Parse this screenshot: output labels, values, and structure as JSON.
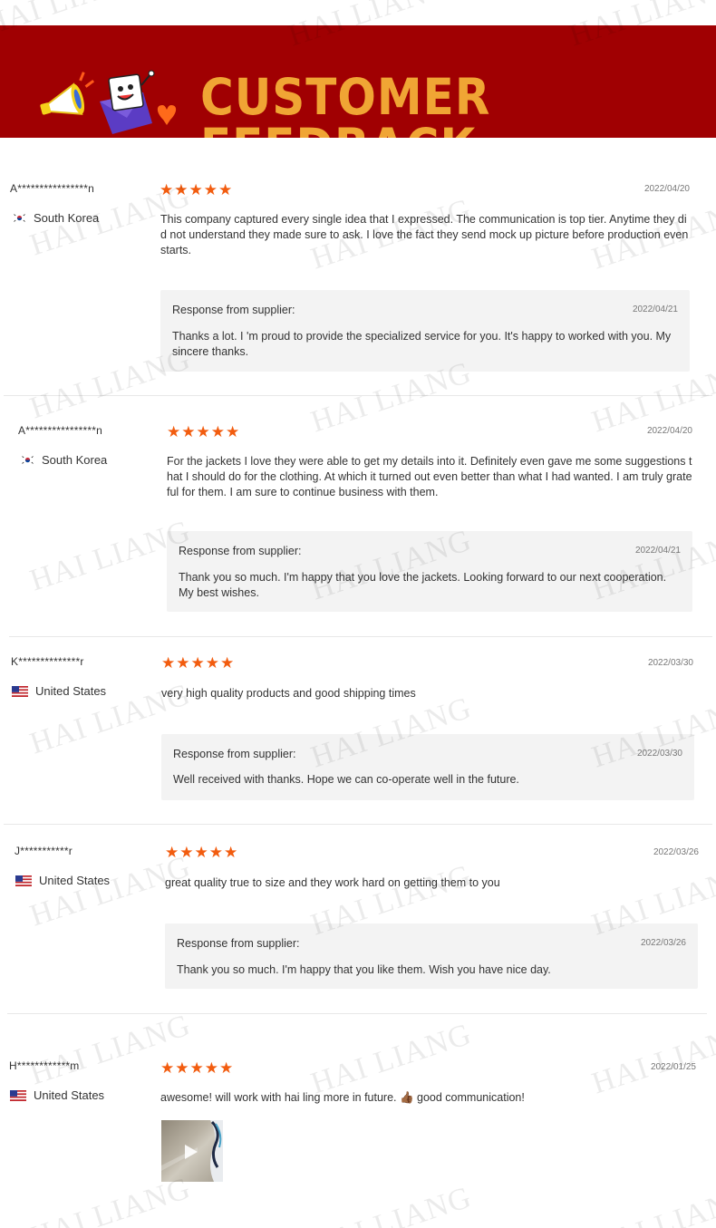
{
  "banner": {
    "title": "CUSTOMER FEEDBACK"
  },
  "watermark": "HAI LIANG",
  "response_label": "Response from supplier:",
  "reviews": [
    {
      "buyer": "A****************n",
      "country": "South Korea",
      "rating": "★★★★★",
      "date": "2022/04/20",
      "comment": "This company captured every single idea that I expressed. The communication is top tier. Anytime they did not understand they made sure to ask. I love the fact they send mock up picture before production even starts.",
      "response_date": "2022/04/21",
      "response": "Thanks a lot. I 'm proud to provide the specialized service for you. It's happy to worked with you. My sincere thanks."
    },
    {
      "buyer": "A****************n",
      "country": "South Korea",
      "rating": "★★★★★",
      "date": "2022/04/20",
      "comment": "For the jackets I love they were able to get my details into it. Definitely even gave me some suggestions that I should do for the clothing. At which it turned out even better than what I had wanted. I am truly grateful for them. I am sure to continue business with them.",
      "response_date": "2022/04/21",
      "response": "Thank you so much. I'm happy that you love the jackets. Looking forward to our next cooperation. My best wishes."
    },
    {
      "buyer": "K**************r",
      "country": "United States",
      "rating": "★★★★★",
      "date": "2022/03/30",
      "comment": "very high quality products and good shipping times",
      "response_date": "2022/03/30",
      "response": "Well received with thanks. Hope we can co-operate well in the future."
    },
    {
      "buyer": "J***********r",
      "country": "United States",
      "rating": "★★★★★",
      "date": "2022/03/26",
      "comment": "great quality true to size and they work hard on getting them to you",
      "response_date": "2022/03/26",
      "response": "Thank you so much. I'm happy that you like them. Wish you have nice day."
    },
    {
      "buyer": "H************m",
      "country": "United States",
      "rating": "★★★★★",
      "date": "2022/01/25",
      "comment": "awesome! will work with hai ling more in future. 👍🏾 good communication!"
    }
  ]
}
